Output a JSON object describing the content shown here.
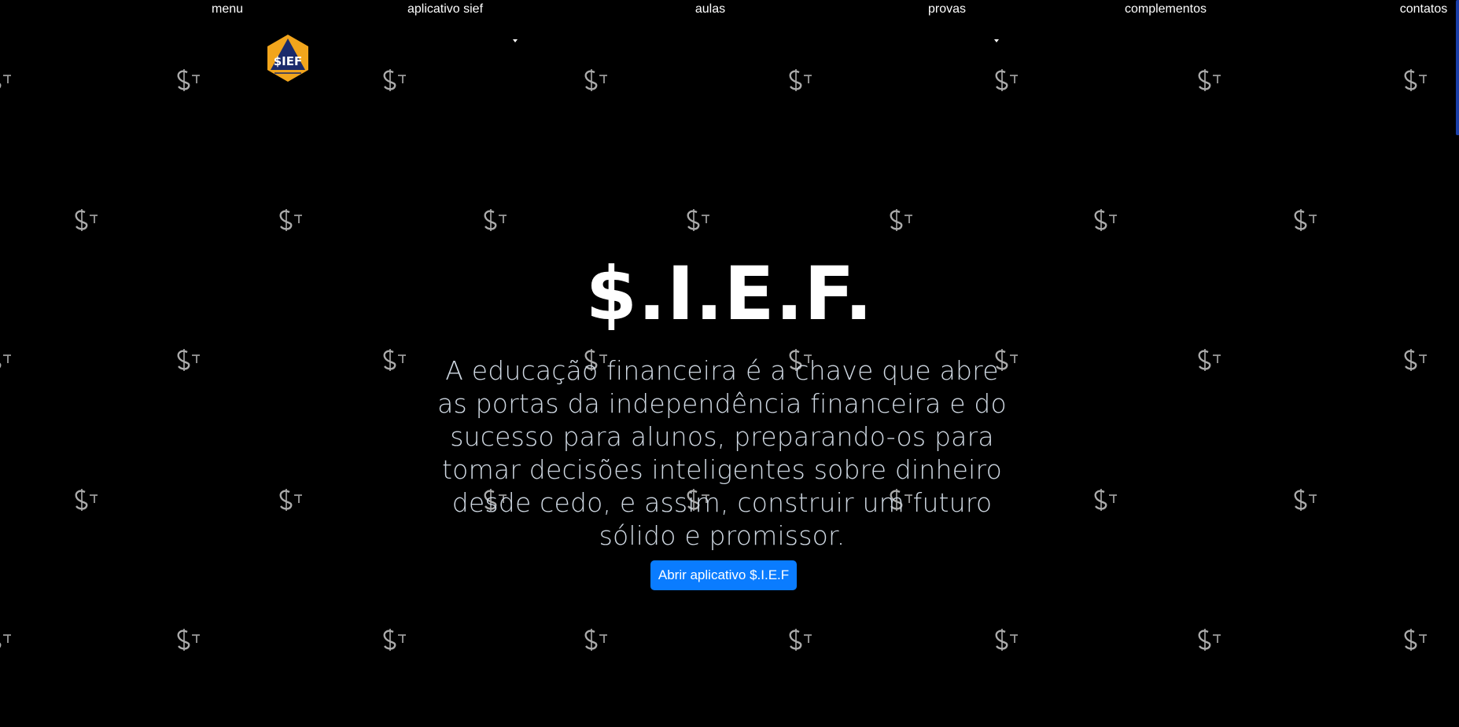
{
  "nav": {
    "items": [
      {
        "label": "menu",
        "has_dropdown": false
      },
      {
        "label": "aplicativo sief",
        "has_dropdown": true
      },
      {
        "label": "aulas",
        "has_dropdown": false
      },
      {
        "label": "provas",
        "has_dropdown": true
      },
      {
        "label": "complementos",
        "has_dropdown": false
      },
      {
        "label": "contatos",
        "has_dropdown": false
      }
    ]
  },
  "logo": {
    "text": "$IEF",
    "icon": "sief-hexagon-logo",
    "colors": {
      "outer": "#f2a51c",
      "inner": "#1a2a6b",
      "text": "#ffffff"
    }
  },
  "background": {
    "color": "#000000",
    "motif_icon": "stylized-dollar-key-icon"
  },
  "hero": {
    "title": "$.I.E.F.",
    "description": "A educação financeira é a chave que abre as portas da independência financeira e do sucesso para alunos, preparando-os para tomar decisões inteligentes sobre dinheiro desde cedo, e assim, construir um futuro sólido e promissor.",
    "button_label": "Abrir aplicativo $.I.E.F"
  },
  "colors": {
    "accent": "#0a7cff",
    "text": "#ffffff",
    "muted_text": "#cfd8e2",
    "scroll_accent": "#1b3fa8"
  }
}
